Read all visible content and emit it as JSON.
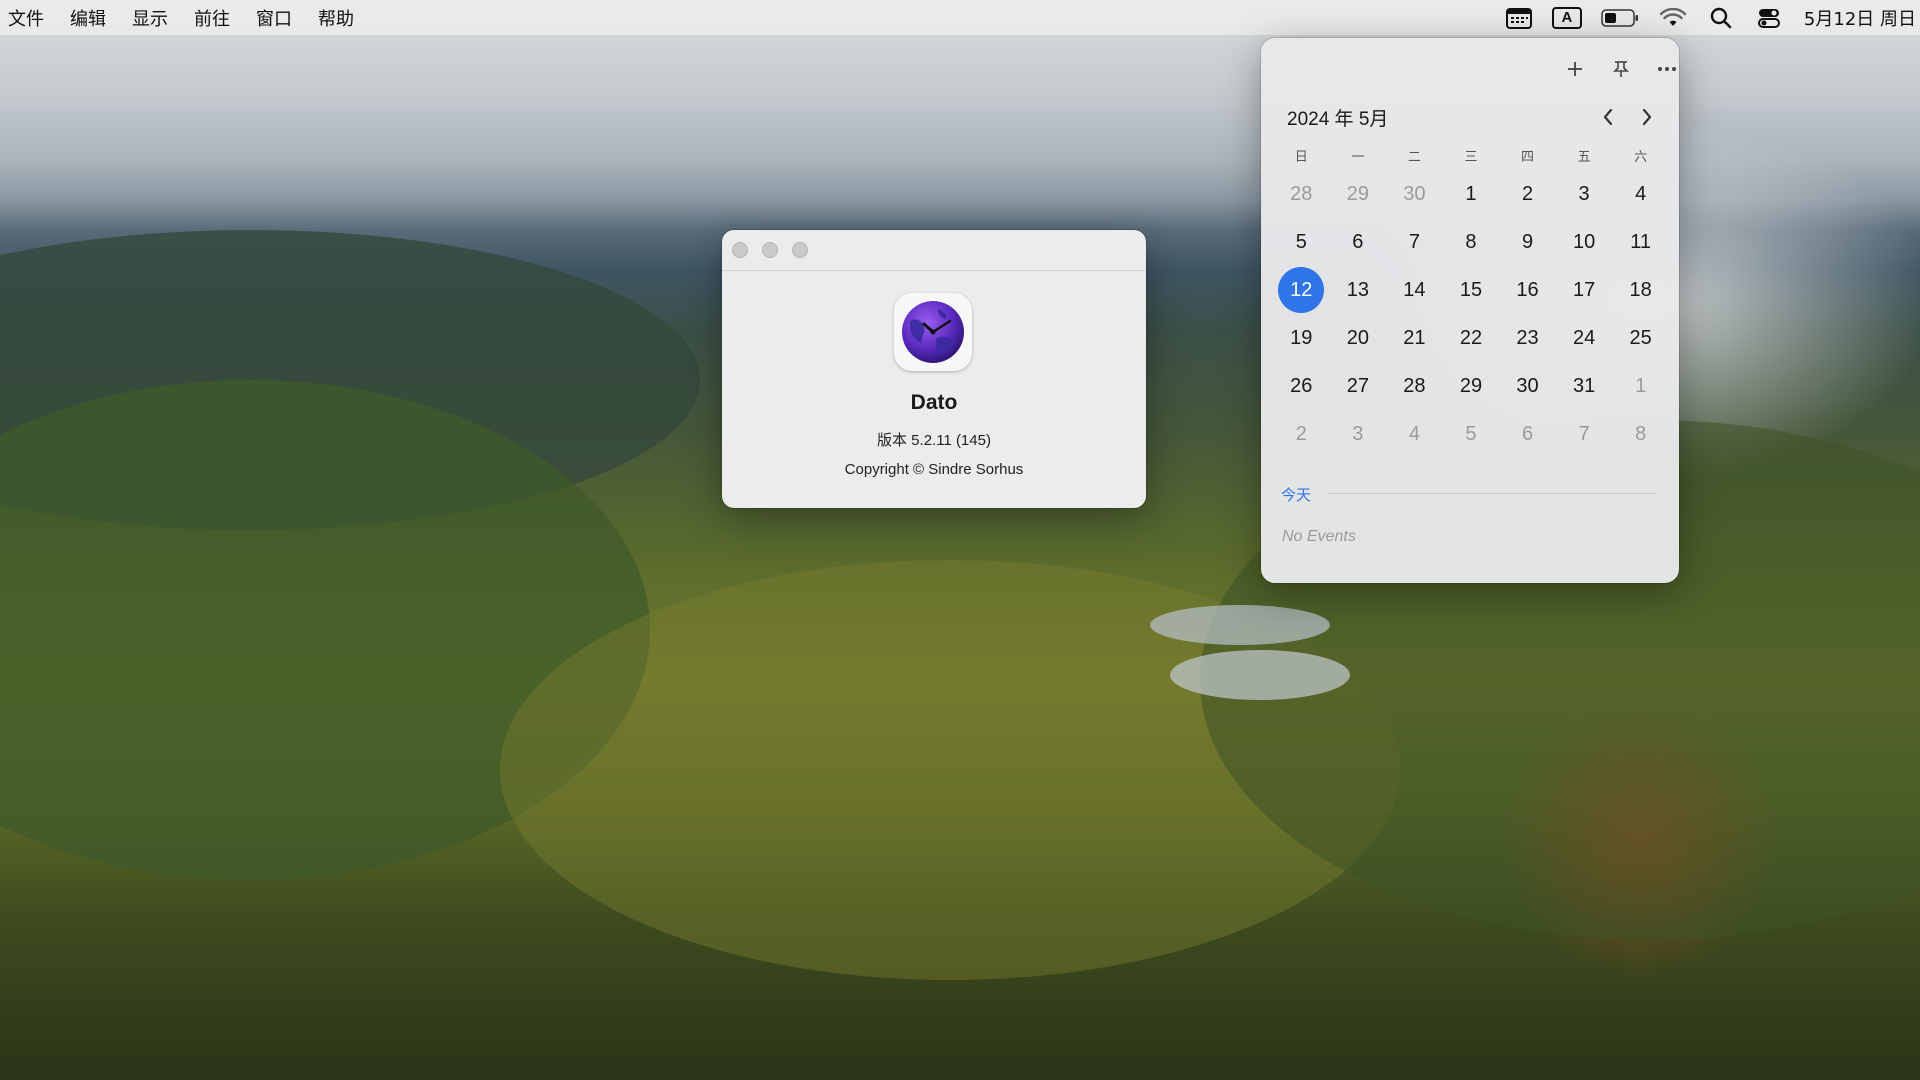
{
  "menubar": {
    "items": [
      "文件",
      "编辑",
      "显示",
      "前往",
      "窗口",
      "帮助"
    ],
    "clock": "5月12日 周日",
    "input_method_label": "A",
    "status_icons": [
      "calendar-icon",
      "input-method-icon",
      "battery-icon",
      "wifi-icon",
      "search-icon",
      "control-center-icon"
    ]
  },
  "about_window": {
    "app_name": "Dato",
    "version": "版本 5.2.11 (145)",
    "copyright": "Copyright © Sindre Sorhus",
    "icon": "globe-clock-icon"
  },
  "calendar": {
    "month_title": "2024 年 5月",
    "toolbar_icons": [
      "add-icon",
      "pin-icon",
      "more-icon"
    ],
    "weekdays": [
      "日",
      "一",
      "二",
      "三",
      "四",
      "五",
      "六"
    ],
    "weeks": [
      [
        {
          "d": "28",
          "o": true
        },
        {
          "d": "29",
          "o": true
        },
        {
          "d": "30",
          "o": true
        },
        {
          "d": "1"
        },
        {
          "d": "2"
        },
        {
          "d": "3"
        },
        {
          "d": "4"
        }
      ],
      [
        {
          "d": "5"
        },
        {
          "d": "6"
        },
        {
          "d": "7"
        },
        {
          "d": "8"
        },
        {
          "d": "9"
        },
        {
          "d": "10"
        },
        {
          "d": "11"
        }
      ],
      [
        {
          "d": "12",
          "today": true
        },
        {
          "d": "13"
        },
        {
          "d": "14"
        },
        {
          "d": "15"
        },
        {
          "d": "16"
        },
        {
          "d": "17"
        },
        {
          "d": "18"
        }
      ],
      [
        {
          "d": "19"
        },
        {
          "d": "20"
        },
        {
          "d": "21"
        },
        {
          "d": "22"
        },
        {
          "d": "23"
        },
        {
          "d": "24"
        },
        {
          "d": "25"
        }
      ],
      [
        {
          "d": "26"
        },
        {
          "d": "27"
        },
        {
          "d": "28"
        },
        {
          "d": "29"
        },
        {
          "d": "30"
        },
        {
          "d": "31"
        },
        {
          "d": "1",
          "o": true
        }
      ],
      [
        {
          "d": "2",
          "o": true
        },
        {
          "d": "3",
          "o": true
        },
        {
          "d": "4",
          "o": true
        },
        {
          "d": "5",
          "o": true
        },
        {
          "d": "6",
          "o": true
        },
        {
          "d": "7",
          "o": true
        },
        {
          "d": "8",
          "o": true
        }
      ]
    ],
    "today_label": "今天",
    "no_events": "No Events",
    "accent_color": "#2f74e8"
  }
}
